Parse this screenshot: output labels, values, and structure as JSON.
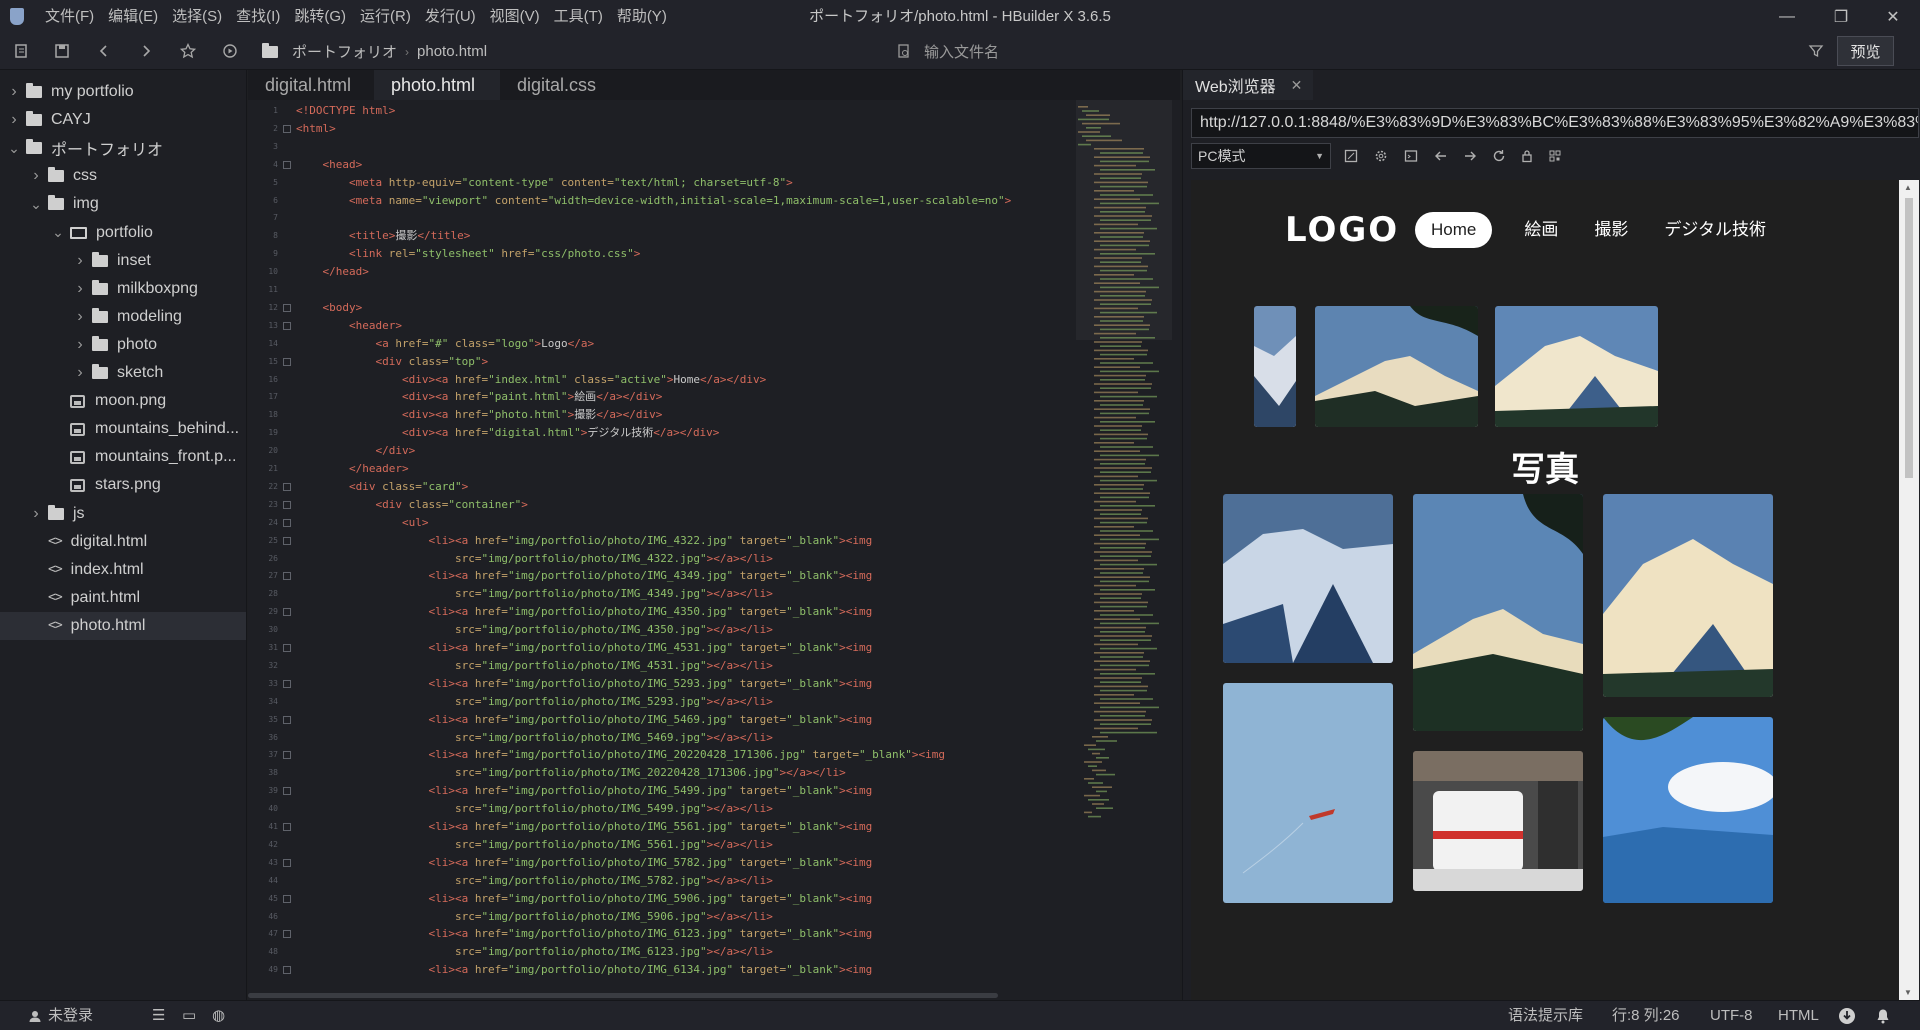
{
  "titlebar": {
    "menus": [
      "文件(F)",
      "编辑(E)",
      "选择(S)",
      "查找(I)",
      "跳转(G)",
      "运行(R)",
      "发行(U)",
      "视图(V)",
      "工具(T)",
      "帮助(Y)"
    ],
    "window_title": "ポートフォリオ/photo.html - HBuilder X 3.6.5",
    "minimize": "—",
    "maximize": "❐",
    "close": "✕"
  },
  "toolbar": {
    "breadcrumb": [
      "ポートフォリオ",
      "photo.html"
    ],
    "file_search_placeholder": "输入文件名",
    "preview_label": "预览",
    "icons": [
      "new-file-icon",
      "save-icon",
      "back-icon",
      "forward-icon",
      "star-icon",
      "run-icon",
      "folder-icon",
      "find-file-icon",
      "filter-icon"
    ]
  },
  "sidebar": {
    "items": [
      {
        "label": "my portfolio",
        "depth": 0,
        "type": "folder",
        "expanded": false
      },
      {
        "label": "CAYJ",
        "depth": 0,
        "type": "folder",
        "expanded": false
      },
      {
        "label": "ポートフォリオ",
        "depth": 0,
        "type": "folder",
        "expanded": true
      },
      {
        "label": "css",
        "depth": 1,
        "type": "folder",
        "expanded": false
      },
      {
        "label": "img",
        "depth": 1,
        "type": "folder",
        "expanded": true
      },
      {
        "label": "portfolio",
        "depth": 2,
        "type": "folder-open",
        "expanded": true
      },
      {
        "label": "inset",
        "depth": 3,
        "type": "folder",
        "expanded": false
      },
      {
        "label": "milkboxpng",
        "depth": 3,
        "type": "folder",
        "expanded": false
      },
      {
        "label": "modeling",
        "depth": 3,
        "type": "folder",
        "expanded": false
      },
      {
        "label": "photo",
        "depth": 3,
        "type": "folder",
        "expanded": false
      },
      {
        "label": "sketch",
        "depth": 3,
        "type": "folder",
        "expanded": false
      },
      {
        "label": "moon.png",
        "depth": 2,
        "type": "image"
      },
      {
        "label": "mountains_behind...",
        "depth": 2,
        "type": "image"
      },
      {
        "label": "mountains_front.p...",
        "depth": 2,
        "type": "image"
      },
      {
        "label": "stars.png",
        "depth": 2,
        "type": "image"
      },
      {
        "label": "js",
        "depth": 1,
        "type": "folder",
        "expanded": false
      },
      {
        "label": "digital.html",
        "depth": 1,
        "type": "code"
      },
      {
        "label": "index.html",
        "depth": 1,
        "type": "code"
      },
      {
        "label": "paint.html",
        "depth": 1,
        "type": "code"
      },
      {
        "label": "photo.html",
        "depth": 1,
        "type": "code",
        "selected": true
      }
    ],
    "bottom_icons": [
      "explorer-icon",
      "debug-icon",
      "search-panel-icon",
      "plugin-icon"
    ]
  },
  "editor": {
    "tabs": [
      {
        "label": "digital.html",
        "active": false
      },
      {
        "label": "photo.html",
        "active": true
      },
      {
        "label": "digital.css",
        "active": false
      }
    ],
    "code_lines": [
      [
        [
          "t",
          "<!DOCTYPE html>"
        ]
      ],
      [
        [
          "t",
          "<html>"
        ]
      ],
      [],
      [
        [
          "x",
          "    "
        ],
        [
          "t",
          "<head>"
        ]
      ],
      [
        [
          "x",
          "        "
        ],
        [
          "t",
          "<meta "
        ],
        [
          "a",
          "http-equiv="
        ],
        [
          "s",
          "\"content-type\" "
        ],
        [
          "a",
          "content="
        ],
        [
          "s",
          "\"text/html; charset=utf-8\""
        ],
        [
          "t",
          ">"
        ]
      ],
      [
        [
          "x",
          "        "
        ],
        [
          "t",
          "<meta "
        ],
        [
          "a",
          "name="
        ],
        [
          "s",
          "\"viewport\" "
        ],
        [
          "a",
          "content="
        ],
        [
          "s",
          "\"width=device-width,initial-scale=1,maximum-scale=1,user-scalable=no\""
        ],
        [
          "t",
          ">"
        ]
      ],
      [],
      [
        [
          "x",
          "        "
        ],
        [
          "t",
          "<title>"
        ],
        [
          "x",
          "撮影"
        ],
        [
          "t",
          "</title>"
        ]
      ],
      [
        [
          "x",
          "        "
        ],
        [
          "t",
          "<link "
        ],
        [
          "a",
          "rel="
        ],
        [
          "s",
          "\"stylesheet\" "
        ],
        [
          "a",
          "href="
        ],
        [
          "s",
          "\"css/photo.css\""
        ],
        [
          "t",
          ">"
        ]
      ],
      [
        [
          "x",
          "    "
        ],
        [
          "t",
          "</head>"
        ]
      ],
      [],
      [
        [
          "x",
          "    "
        ],
        [
          "t",
          "<body>"
        ]
      ],
      [
        [
          "x",
          "        "
        ],
        [
          "t",
          "<header>"
        ]
      ],
      [
        [
          "x",
          "            "
        ],
        [
          "t",
          "<a "
        ],
        [
          "a",
          "href="
        ],
        [
          "s",
          "\"#\" "
        ],
        [
          "a",
          "class="
        ],
        [
          "s",
          "\"logo\""
        ],
        [
          "t",
          ">"
        ],
        [
          "x",
          "Logo"
        ],
        [
          "t",
          "</a>"
        ]
      ],
      [
        [
          "x",
          "            "
        ],
        [
          "t",
          "<div "
        ],
        [
          "a",
          "class="
        ],
        [
          "s",
          "\"top\""
        ],
        [
          "t",
          ">"
        ]
      ],
      [
        [
          "x",
          "                "
        ],
        [
          "t",
          "<div><a "
        ],
        [
          "a",
          "href="
        ],
        [
          "s",
          "\"index.html\" "
        ],
        [
          "a",
          "class="
        ],
        [
          "s",
          "\"active\""
        ],
        [
          "t",
          ">"
        ],
        [
          "x",
          "Home"
        ],
        [
          "t",
          "</a></div>"
        ]
      ],
      [
        [
          "x",
          "                "
        ],
        [
          "t",
          "<div><a "
        ],
        [
          "a",
          "href="
        ],
        [
          "s",
          "\"paint.html\""
        ],
        [
          "t",
          ">"
        ],
        [
          "x",
          "絵画"
        ],
        [
          "t",
          "</a></div>"
        ]
      ],
      [
        [
          "x",
          "                "
        ],
        [
          "t",
          "<div><a "
        ],
        [
          "a",
          "href="
        ],
        [
          "s",
          "\"photo.html\""
        ],
        [
          "t",
          ">"
        ],
        [
          "x",
          "撮影"
        ],
        [
          "t",
          "</a></div>"
        ]
      ],
      [
        [
          "x",
          "                "
        ],
        [
          "t",
          "<div><a "
        ],
        [
          "a",
          "href="
        ],
        [
          "s",
          "\"digital.html\""
        ],
        [
          "t",
          ">"
        ],
        [
          "x",
          "デジタル技術"
        ],
        [
          "t",
          "</a></div>"
        ]
      ],
      [
        [
          "x",
          "            "
        ],
        [
          "t",
          "</div>"
        ]
      ],
      [
        [
          "x",
          "        "
        ],
        [
          "t",
          "</header>"
        ]
      ],
      [
        [
          "x",
          "        "
        ],
        [
          "t",
          "<div "
        ],
        [
          "a",
          "class="
        ],
        [
          "s",
          "\"card\""
        ],
        [
          "t",
          ">"
        ]
      ],
      [
        [
          "x",
          "            "
        ],
        [
          "t",
          "<div "
        ],
        [
          "a",
          "class="
        ],
        [
          "s",
          "\"container\""
        ],
        [
          "t",
          ">"
        ]
      ],
      [
        [
          "x",
          "                "
        ],
        [
          "t",
          "<ul>"
        ]
      ],
      [
        [
          "x",
          "                    "
        ],
        [
          "t",
          "<li><a "
        ],
        [
          "a",
          "href="
        ],
        [
          "s",
          "\"img/portfolio/photo/IMG_4322.jpg\" "
        ],
        [
          "a",
          "target="
        ],
        [
          "s",
          "\"_blank\""
        ],
        [
          "t",
          "><img"
        ]
      ],
      [
        [
          "x",
          "                        "
        ],
        [
          "a",
          "src="
        ],
        [
          "s",
          "\"img/portfolio/photo/IMG_4322.jpg\""
        ],
        [
          "t",
          "></a></li>"
        ]
      ],
      [
        [
          "x",
          "                    "
        ],
        [
          "t",
          "<li><a "
        ],
        [
          "a",
          "href="
        ],
        [
          "s",
          "\"img/portfolio/photo/IMG_4349.jpg\" "
        ],
        [
          "a",
          "target="
        ],
        [
          "s",
          "\"_blank\""
        ],
        [
          "t",
          "><img"
        ]
      ],
      [
        [
          "x",
          "                        "
        ],
        [
          "a",
          "src="
        ],
        [
          "s",
          "\"img/portfolio/photo/IMG_4349.jpg\""
        ],
        [
          "t",
          "></a></li>"
        ]
      ],
      [
        [
          "x",
          "                    "
        ],
        [
          "t",
          "<li><a "
        ],
        [
          "a",
          "href="
        ],
        [
          "s",
          "\"img/portfolio/photo/IMG_4350.jpg\" "
        ],
        [
          "a",
          "target="
        ],
        [
          "s",
          "\"_blank\""
        ],
        [
          "t",
          "><img"
        ]
      ],
      [
        [
          "x",
          "                        "
        ],
        [
          "a",
          "src="
        ],
        [
          "s",
          "\"img/portfolio/photo/IMG_4350.jpg\""
        ],
        [
          "t",
          "></a></li>"
        ]
      ],
      [
        [
          "x",
          "                    "
        ],
        [
          "t",
          "<li><a "
        ],
        [
          "a",
          "href="
        ],
        [
          "s",
          "\"img/portfolio/photo/IMG_4531.jpg\" "
        ],
        [
          "a",
          "target="
        ],
        [
          "s",
          "\"_blank\""
        ],
        [
          "t",
          "><img"
        ]
      ],
      [
        [
          "x",
          "                        "
        ],
        [
          "a",
          "src="
        ],
        [
          "s",
          "\"img/portfolio/photo/IMG_4531.jpg\""
        ],
        [
          "t",
          "></a></li>"
        ]
      ],
      [
        [
          "x",
          "                    "
        ],
        [
          "t",
          "<li><a "
        ],
        [
          "a",
          "href="
        ],
        [
          "s",
          "\"img/portfolio/photo/IMG_5293.jpg\" "
        ],
        [
          "a",
          "target="
        ],
        [
          "s",
          "\"_blank\""
        ],
        [
          "t",
          "><img"
        ]
      ],
      [
        [
          "x",
          "                        "
        ],
        [
          "a",
          "src="
        ],
        [
          "s",
          "\"img/portfolio/photo/IMG_5293.jpg\""
        ],
        [
          "t",
          "></a></li>"
        ]
      ],
      [
        [
          "x",
          "                    "
        ],
        [
          "t",
          "<li><a "
        ],
        [
          "a",
          "href="
        ],
        [
          "s",
          "\"img/portfolio/photo/IMG_5469.jpg\" "
        ],
        [
          "a",
          "target="
        ],
        [
          "s",
          "\"_blank\""
        ],
        [
          "t",
          "><img"
        ]
      ],
      [
        [
          "x",
          "                        "
        ],
        [
          "a",
          "src="
        ],
        [
          "s",
          "\"img/portfolio/photo/IMG_5469.jpg\""
        ],
        [
          "t",
          "></a></li>"
        ]
      ],
      [
        [
          "x",
          "                    "
        ],
        [
          "t",
          "<li><a "
        ],
        [
          "a",
          "href="
        ],
        [
          "s",
          "\"img/portfolio/photo/IMG_20220428_171306.jpg\" "
        ],
        [
          "a",
          "target="
        ],
        [
          "s",
          "\"_blank\""
        ],
        [
          "t",
          "><img"
        ]
      ],
      [
        [
          "x",
          "                        "
        ],
        [
          "a",
          "src="
        ],
        [
          "s",
          "\"img/portfolio/photo/IMG_20220428_171306.jpg\""
        ],
        [
          "t",
          "></a></li>"
        ]
      ],
      [
        [
          "x",
          "                    "
        ],
        [
          "t",
          "<li><a "
        ],
        [
          "a",
          "href="
        ],
        [
          "s",
          "\"img/portfolio/photo/IMG_5499.jpg\" "
        ],
        [
          "a",
          "target="
        ],
        [
          "s",
          "\"_blank\""
        ],
        [
          "t",
          "><img"
        ]
      ],
      [
        [
          "x",
          "                        "
        ],
        [
          "a",
          "src="
        ],
        [
          "s",
          "\"img/portfolio/photo/IMG_5499.jpg\""
        ],
        [
          "t",
          "></a></li>"
        ]
      ],
      [
        [
          "x",
          "                    "
        ],
        [
          "t",
          "<li><a "
        ],
        [
          "a",
          "href="
        ],
        [
          "s",
          "\"img/portfolio/photo/IMG_5561.jpg\" "
        ],
        [
          "a",
          "target="
        ],
        [
          "s",
          "\"_blank\""
        ],
        [
          "t",
          "><img"
        ]
      ],
      [
        [
          "x",
          "                        "
        ],
        [
          "a",
          "src="
        ],
        [
          "s",
          "\"img/portfolio/photo/IMG_5561.jpg\""
        ],
        [
          "t",
          "></a></li>"
        ]
      ],
      [
        [
          "x",
          "                    "
        ],
        [
          "t",
          "<li><a "
        ],
        [
          "a",
          "href="
        ],
        [
          "s",
          "\"img/portfolio/photo/IMG_5782.jpg\" "
        ],
        [
          "a",
          "target="
        ],
        [
          "s",
          "\"_blank\""
        ],
        [
          "t",
          "><img"
        ]
      ],
      [
        [
          "x",
          "                        "
        ],
        [
          "a",
          "src="
        ],
        [
          "s",
          "\"img/portfolio/photo/IMG_5782.jpg\""
        ],
        [
          "t",
          "></a></li>"
        ]
      ],
      [
        [
          "x",
          "                    "
        ],
        [
          "t",
          "<li><a "
        ],
        [
          "a",
          "href="
        ],
        [
          "s",
          "\"img/portfolio/photo/IMG_5906.jpg\" "
        ],
        [
          "a",
          "target="
        ],
        [
          "s",
          "\"_blank\""
        ],
        [
          "t",
          "><img"
        ]
      ],
      [
        [
          "x",
          "                        "
        ],
        [
          "a",
          "src="
        ],
        [
          "s",
          "\"img/portfolio/photo/IMG_5906.jpg\""
        ],
        [
          "t",
          "></a></li>"
        ]
      ],
      [
        [
          "x",
          "                    "
        ],
        [
          "t",
          "<li><a "
        ],
        [
          "a",
          "href="
        ],
        [
          "s",
          "\"img/portfolio/photo/IMG_6123.jpg\" "
        ],
        [
          "a",
          "target="
        ],
        [
          "s",
          "\"_blank\""
        ],
        [
          "t",
          "><img"
        ]
      ],
      [
        [
          "x",
          "                        "
        ],
        [
          "a",
          "src="
        ],
        [
          "s",
          "\"img/portfolio/photo/IMG_6123.jpg\""
        ],
        [
          "t",
          "></a></li>"
        ]
      ],
      [
        [
          "x",
          "                    "
        ],
        [
          "t",
          "<li><a "
        ],
        [
          "a",
          "href="
        ],
        [
          "s",
          "\"img/portfolio/photo/IMG_6134.jpg\" "
        ],
        [
          "a",
          "target="
        ],
        [
          "s",
          "\"_blank\""
        ],
        [
          "t",
          "><img"
        ]
      ]
    ]
  },
  "browser": {
    "tab_label": "Web浏览器",
    "tab_close": "✕",
    "url": "http://127.0.0.1:8848/%E3%83%9D%E3%83%BC%E3%83%88%E3%83%95%E3%82%A9%E3%83%AA%E3%82%AA/photo.html",
    "mode": "PC模式",
    "icons": [
      "screenshot-icon",
      "settings-icon",
      "devtools-icon",
      "back-arrow-icon",
      "forward-arrow-icon",
      "reload-icon",
      "lock-icon",
      "qr-icon"
    ],
    "page": {
      "logo": "LOGO",
      "nav": [
        {
          "label": "Home",
          "active": true
        },
        {
          "label": "絵画",
          "active": false
        },
        {
          "label": "撮影",
          "active": false
        },
        {
          "label": "デジタル技術",
          "active": false
        }
      ],
      "title": "写真"
    }
  },
  "statusbar": {
    "login": "未登录",
    "language_hint": "语法提示库",
    "position": "行:8  列:26",
    "encoding": "UTF-8",
    "language": "HTML"
  },
  "colors": {
    "background": "#1e1f24",
    "tag": "#d46a5a",
    "attribute": "#c3a26a",
    "string": "#8fbf6a",
    "web_background": "#1f1f1f"
  }
}
